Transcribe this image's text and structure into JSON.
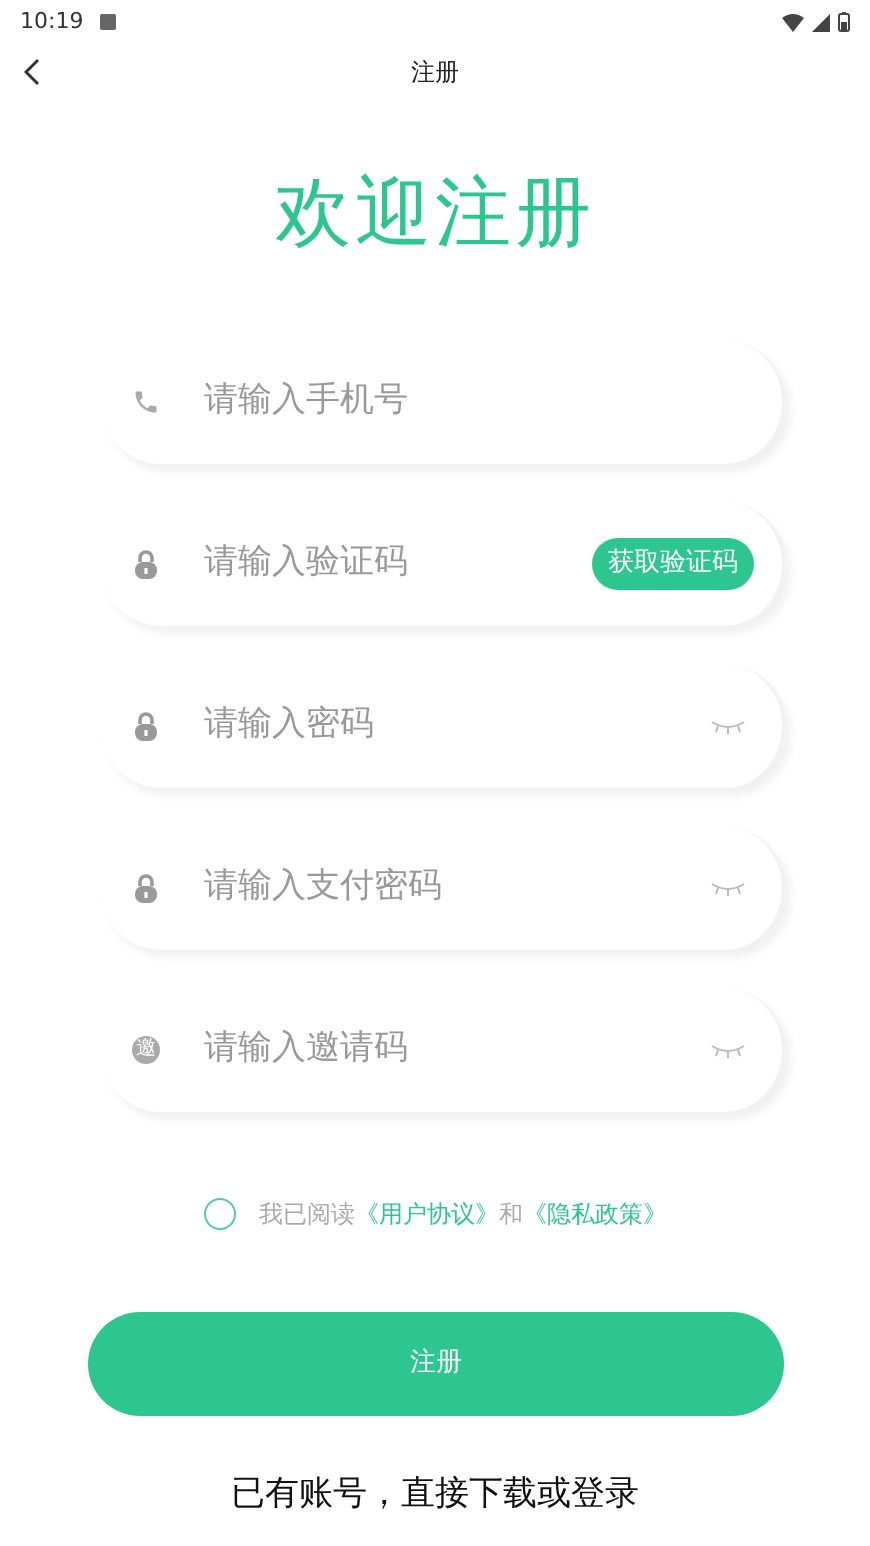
{
  "status_bar": {
    "time": "10:19"
  },
  "header": {
    "title": "注册"
  },
  "heading": "欢迎注册",
  "fields": [
    {
      "kind": "phone",
      "placeholder": "请输入手机号"
    },
    {
      "kind": "code",
      "placeholder": "请输入验证码",
      "button": "获取验证码"
    },
    {
      "kind": "password",
      "placeholder": "请输入密码"
    },
    {
      "kind": "password",
      "placeholder": "请输入支付密码"
    },
    {
      "kind": "invite",
      "placeholder": "请输入邀请码",
      "icon_text": "邀"
    }
  ],
  "agreement": {
    "checked": false,
    "prefix": "我已阅读",
    "link1": "《用户协议》",
    "middle": "和",
    "link2": "《隐私政策》"
  },
  "submit": "注册",
  "footer": "已有账号，直接下载或登录"
}
